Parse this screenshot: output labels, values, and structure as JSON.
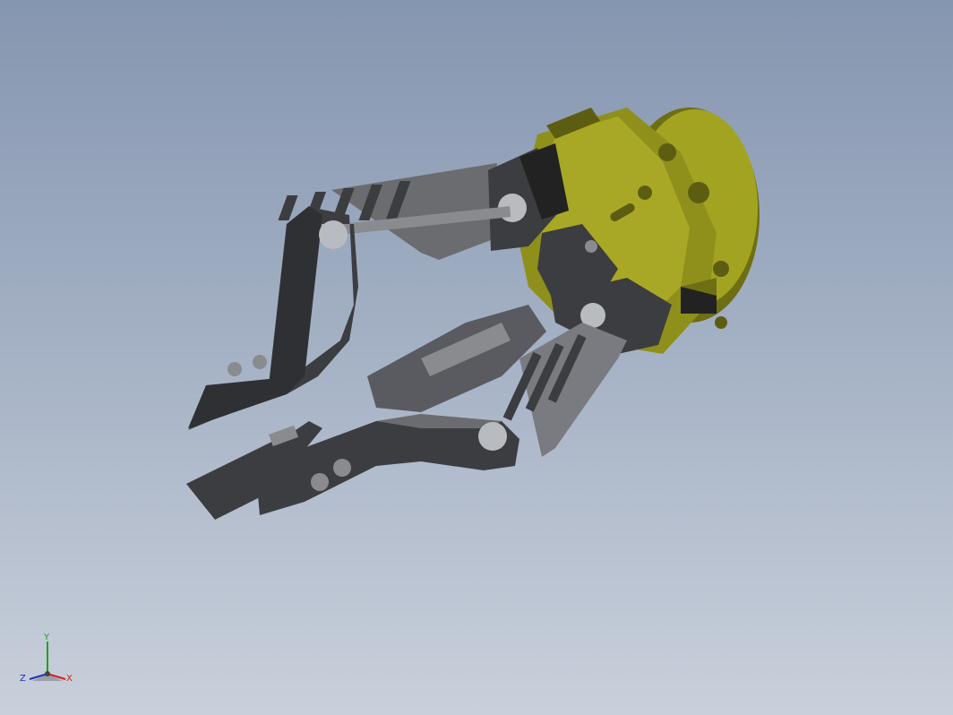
{
  "window": {
    "background_top": "#8596b0",
    "background_bottom": "#c9d0db"
  },
  "model": {
    "part_colors": {
      "body": "#a3a322",
      "body_shadow": "#5d5d12",
      "jaw": "#3c3d40",
      "jaw_light": "#6b6c70",
      "plate": "#8a8b8f",
      "bolt": "#b8bbc0"
    }
  },
  "triad": {
    "x_label": "X",
    "y_label": "Y",
    "z_label": "Z",
    "x_color": "#d02020",
    "y_color": "#20a020",
    "z_color": "#2030c0"
  }
}
